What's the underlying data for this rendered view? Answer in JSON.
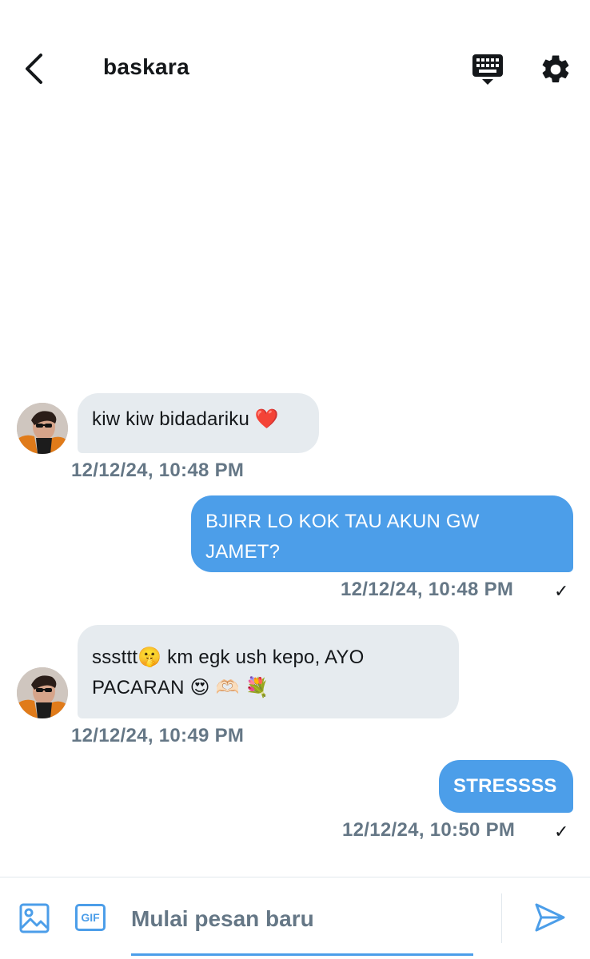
{
  "header": {
    "title": "baskara",
    "icons": {
      "back": "chevron-left-icon",
      "keyboard": "keyboard-icon",
      "settings": "gear-icon"
    }
  },
  "messages": [
    {
      "direction": "in",
      "text": "kiw kiw bidadariku ❤️",
      "time": "12/12/24, 10:48 PM"
    },
    {
      "direction": "out",
      "text": "BJIRR LO KOK TAU AKUN GW JAMET?",
      "time": "12/12/24, 10:48 PM",
      "status": "✓"
    },
    {
      "direction": "in",
      "text": "sssttt🤫 km egk ush kepo, AYO PACARAN 😍 🫶🏻 💐",
      "time": "12/12/24, 10:49 PM"
    },
    {
      "direction": "out",
      "text": "STRESSSS",
      "time": "12/12/24, 10:50 PM",
      "status": "✓"
    }
  ],
  "composer": {
    "placeholder": "Mulai pesan baru",
    "gif_label": "GIF",
    "icons": {
      "image": "image-icon",
      "send": "send-icon"
    }
  },
  "colors": {
    "accent": "#4c9ee9",
    "incoming_bubble": "#e6ebef",
    "timestamp": "#657786",
    "text": "#14171a"
  }
}
